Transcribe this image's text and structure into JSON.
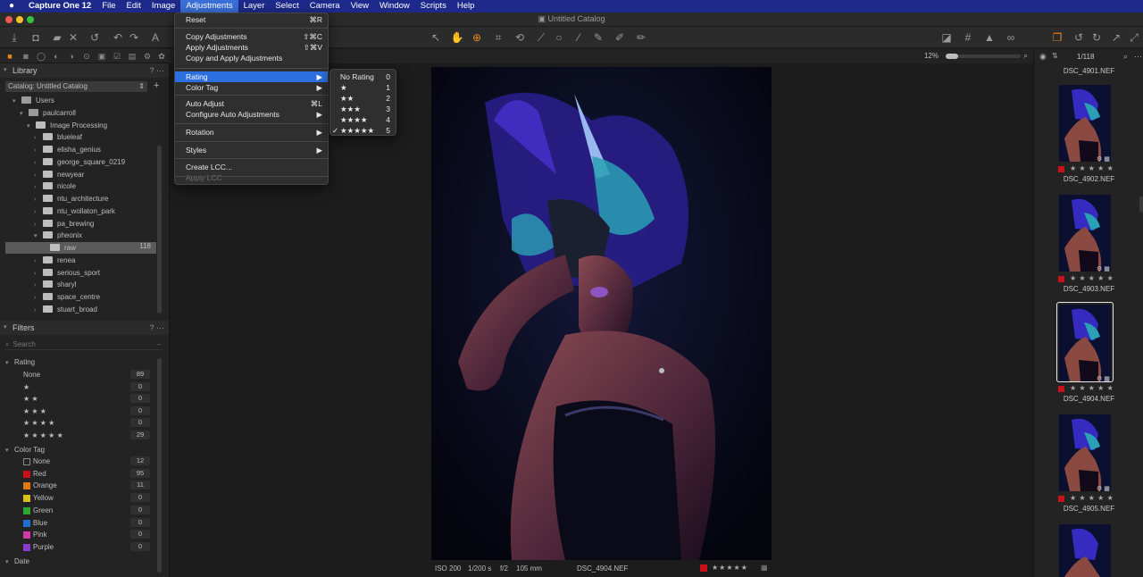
{
  "menubar": {
    "apple": "",
    "app": "Capture One 12",
    "items": [
      "File",
      "Edit",
      "Image",
      "Adjustments",
      "Layer",
      "Select",
      "Camera",
      "View",
      "Window",
      "Scripts",
      "Help"
    ]
  },
  "window": {
    "title": "Untitled Catalog"
  },
  "colors": {
    "menubar": "#1d2a8c",
    "highlight": "#2c6fe0",
    "accent_orange": "#e8891d",
    "red_tag": "#c8101a"
  },
  "library": {
    "title": "Library",
    "catalog": "Catalog: Untitled Catalog",
    "tree": [
      {
        "label": "Users",
        "level": 0
      },
      {
        "label": "paulcarroll",
        "level": 1
      },
      {
        "label": "Image Processing",
        "level": 2
      },
      {
        "label": "blueleaf",
        "level": 3
      },
      {
        "label": "elisha_genius",
        "level": 3
      },
      {
        "label": "george_square_0219",
        "level": 3
      },
      {
        "label": "newyear",
        "level": 3
      },
      {
        "label": "nicole",
        "level": 3
      },
      {
        "label": "ntu_architecture",
        "level": 3
      },
      {
        "label": "ntu_wollaton_park",
        "level": 3
      },
      {
        "label": "pa_brewing",
        "level": 3
      },
      {
        "label": "pheonix",
        "level": 3
      },
      {
        "label": "raw",
        "level": 4,
        "count": "118",
        "selected": true
      },
      {
        "label": "renea",
        "level": 3
      },
      {
        "label": "serious_sport",
        "level": 3
      },
      {
        "label": "sharyl",
        "level": 3
      },
      {
        "label": "space_centre",
        "level": 3
      },
      {
        "label": "stuart_broad",
        "level": 3
      }
    ]
  },
  "filters": {
    "title": "Filters",
    "search_placeholder": "Search",
    "rating_title": "Rating",
    "ratings": [
      {
        "label": "None",
        "count": "89"
      },
      {
        "label": "★",
        "count": "0"
      },
      {
        "label": "★ ★",
        "count": "0"
      },
      {
        "label": "★ ★ ★",
        "count": "0"
      },
      {
        "label": "★ ★ ★ ★",
        "count": "0"
      },
      {
        "label": "★ ★ ★ ★ ★",
        "count": "29"
      }
    ],
    "color_title": "Color Tag",
    "colors": [
      {
        "label": "None",
        "count": "12",
        "color": "none"
      },
      {
        "label": "Red",
        "count": "95",
        "color": "#c8101a"
      },
      {
        "label": "Orange",
        "count": "11",
        "color": "#e07a10"
      },
      {
        "label": "Yellow",
        "count": "0",
        "color": "#d8c21a"
      },
      {
        "label": "Green",
        "count": "0",
        "color": "#2fa82f"
      },
      {
        "label": "Blue",
        "count": "0",
        "color": "#1f6fd0"
      },
      {
        "label": "Pink",
        "count": "0",
        "color": "#d03aa8"
      },
      {
        "label": "Purple",
        "count": "0",
        "color": "#8a3acd"
      }
    ],
    "date_title": "Date"
  },
  "viewer": {
    "zoom": "12%",
    "meta": {
      "iso": "ISO 200",
      "shutter": "1/200 s",
      "aperture": "f/2",
      "focal": "105 mm",
      "filename": "DSC_4904.NEF"
    }
  },
  "browser": {
    "count": "1/118",
    "top_name": "DSC_4901.NEF",
    "thumbs": [
      {
        "name": "DSC_4902.NEF"
      },
      {
        "name": "DSC_4903.NEF"
      },
      {
        "name": "DSC_4904.NEF",
        "selected": true
      },
      {
        "name": "DSC_4905.NEF"
      }
    ]
  },
  "adjustments_menu": {
    "items": [
      {
        "label": "Reset",
        "shortcut": "⌘R",
        "group": 0
      },
      {
        "label": "Copy Adjustments",
        "shortcut": "⇧⌘C",
        "group": 1
      },
      {
        "label": "Apply Adjustments",
        "shortcut": "⇧⌘V",
        "group": 1
      },
      {
        "label": "Copy and Apply Adjustments",
        "shortcut": "",
        "group": 1
      },
      {
        "label": "Rating",
        "shortcut": "▶",
        "group": 2,
        "highlight": true
      },
      {
        "label": "Color Tag",
        "shortcut": "▶",
        "group": 2
      },
      {
        "label": "Auto Adjust",
        "shortcut": "⌘L",
        "group": 3
      },
      {
        "label": "Configure Auto Adjustments",
        "shortcut": "▶",
        "group": 3
      },
      {
        "label": "Rotation",
        "shortcut": "▶",
        "group": 4
      },
      {
        "label": "Styles",
        "shortcut": "▶",
        "group": 5
      },
      {
        "label": "Create LCC...",
        "shortcut": "",
        "group": 6
      },
      {
        "label": "Apply LCC",
        "shortcut": "",
        "group": 6,
        "disabled": true
      }
    ]
  },
  "rating_submenu": {
    "items": [
      {
        "label": "No Rating",
        "key": "0"
      },
      {
        "label": "★",
        "key": "1"
      },
      {
        "label": "★★",
        "key": "2"
      },
      {
        "label": "★★★",
        "key": "3"
      },
      {
        "label": "★★★★",
        "key": "4"
      },
      {
        "label": "★★★★★",
        "key": "5",
        "checked": true
      }
    ]
  }
}
